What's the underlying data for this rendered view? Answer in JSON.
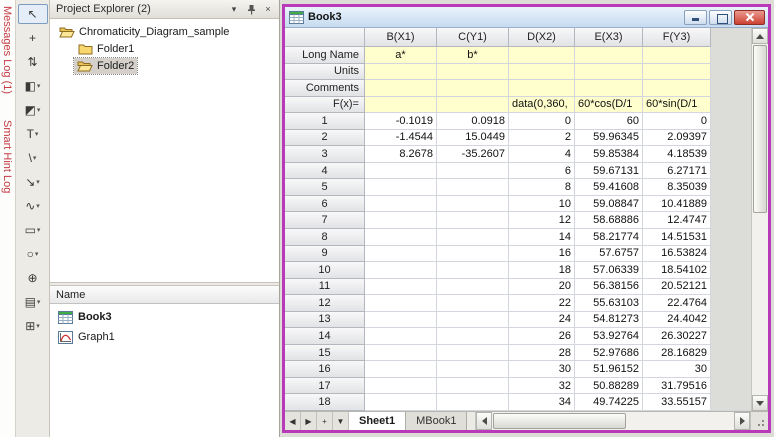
{
  "colors": {
    "active_window_border": "#b93ab9",
    "label_row_background": "#ffffcd",
    "dock_tab_text": "#c43b44"
  },
  "dock_tabs": [
    {
      "label": "Messages Log (1)"
    },
    {
      "label": "Smart Hint Log"
    }
  ],
  "toolbar": {
    "items": [
      {
        "name": "pointer-tool",
        "glyph": "↖",
        "dropdown": false,
        "selected": true
      },
      {
        "name": "screen-reader-tool",
        "glyph": "+",
        "dropdown": false,
        "selected": false
      },
      {
        "name": "data-selector-tool",
        "glyph": "⇅",
        "dropdown": false,
        "selected": false
      },
      {
        "name": "mask-tool",
        "glyph": "◧",
        "dropdown": true,
        "selected": false
      },
      {
        "name": "draw-data-tool",
        "glyph": "◩",
        "dropdown": true,
        "selected": false
      },
      {
        "name": "text-tool",
        "glyph": "T",
        "dropdown": true,
        "selected": false
      },
      {
        "name": "line-tool",
        "glyph": "\\",
        "dropdown": true,
        "selected": false
      },
      {
        "name": "arrow-tool",
        "glyph": "↘",
        "dropdown": true,
        "selected": false
      },
      {
        "name": "curve-tool",
        "glyph": "∿",
        "dropdown": true,
        "selected": false
      },
      {
        "name": "rectangle-tool",
        "glyph": "▭",
        "dropdown": true,
        "selected": false
      },
      {
        "name": "circle-tool",
        "glyph": "○",
        "dropdown": true,
        "selected": false
      },
      {
        "name": "pan-tool",
        "glyph": "⊕",
        "dropdown": false,
        "selected": false
      },
      {
        "name": "fill-area-tool",
        "glyph": "▤",
        "dropdown": true,
        "selected": false
      },
      {
        "name": "insert-graph-tool",
        "glyph": "⊞",
        "dropdown": true,
        "selected": false
      }
    ]
  },
  "project_explorer": {
    "title": "Project Explorer (2)",
    "buttons": [
      {
        "name": "window-position",
        "glyph": "▾"
      },
      {
        "name": "auto-hide-pin",
        "glyph": "pin"
      },
      {
        "name": "close",
        "glyph": "×"
      }
    ],
    "tree": [
      {
        "label": "Chromaticity_Diagram_sample",
        "level": 0,
        "icon": "folder-open",
        "selected": false
      },
      {
        "label": "Folder1",
        "level": 1,
        "icon": "folder-closed",
        "selected": false
      },
      {
        "label": "Folder2",
        "level": 1,
        "icon": "folder-open",
        "selected": true
      }
    ],
    "list": {
      "header": "Name",
      "items": [
        {
          "label": "Book3",
          "icon": "worksheet",
          "bold": true
        },
        {
          "label": "Graph1",
          "icon": "graph",
          "bold": false
        }
      ]
    }
  },
  "book_window": {
    "title": "Book3",
    "window_buttons": [
      "minimize",
      "maximize",
      "close"
    ],
    "columns": [
      "B(X1)",
      "C(Y1)",
      "D(X2)",
      "E(X3)",
      "F(Y3)"
    ],
    "label_rows": [
      {
        "header": "Long Name",
        "align": "center",
        "cells": [
          "a*",
          "b*",
          "",
          "",
          ""
        ]
      },
      {
        "header": "Units",
        "align": "center",
        "cells": [
          "",
          "",
          "",
          "",
          ""
        ]
      },
      {
        "header": "Comments",
        "align": "center",
        "cells": [
          "",
          "",
          "",
          "",
          ""
        ]
      },
      {
        "header": "F(x)=",
        "align": "left",
        "cells": [
          "",
          "",
          "data(0,360,",
          "60*cos(D/1",
          "60*sin(D/1"
        ]
      }
    ],
    "data_rows": [
      {
        "header": "1",
        "cells": [
          "-0.1019",
          "0.0918",
          "0",
          "60",
          "0"
        ]
      },
      {
        "header": "2",
        "cells": [
          "-1.4544",
          "15.0449",
          "2",
          "59.96345",
          "2.09397"
        ]
      },
      {
        "header": "3",
        "cells": [
          "8.2678",
          "-35.2607",
          "4",
          "59.85384",
          "4.18539"
        ]
      },
      {
        "header": "4",
        "cells": [
          "",
          "",
          "6",
          "59.67131",
          "6.27171"
        ]
      },
      {
        "header": "5",
        "cells": [
          "",
          "",
          "8",
          "59.41608",
          "8.35039"
        ]
      },
      {
        "header": "6",
        "cells": [
          "",
          "",
          "10",
          "59.08847",
          "10.41889"
        ]
      },
      {
        "header": "7",
        "cells": [
          "",
          "",
          "12",
          "58.68886",
          "12.4747"
        ]
      },
      {
        "header": "8",
        "cells": [
          "",
          "",
          "14",
          "58.21774",
          "14.51531"
        ]
      },
      {
        "header": "9",
        "cells": [
          "",
          "",
          "16",
          "57.6757",
          "16.53824"
        ]
      },
      {
        "header": "10",
        "cells": [
          "",
          "",
          "18",
          "57.06339",
          "18.54102"
        ]
      },
      {
        "header": "11",
        "cells": [
          "",
          "",
          "20",
          "56.38156",
          "20.52121"
        ]
      },
      {
        "header": "12",
        "cells": [
          "",
          "",
          "22",
          "55.63103",
          "22.4764"
        ]
      },
      {
        "header": "13",
        "cells": [
          "",
          "",
          "24",
          "54.81273",
          "24.4042"
        ]
      },
      {
        "header": "14",
        "cells": [
          "",
          "",
          "26",
          "53.92764",
          "26.30227"
        ]
      },
      {
        "header": "15",
        "cells": [
          "",
          "",
          "28",
          "52.97686",
          "28.16829"
        ]
      },
      {
        "header": "16",
        "cells": [
          "",
          "",
          "30",
          "51.96152",
          "30"
        ]
      },
      {
        "header": "17",
        "cells": [
          "",
          "",
          "32",
          "50.88289",
          "31.79516"
        ]
      },
      {
        "header": "18",
        "cells": [
          "",
          "",
          "34",
          "49.74225",
          "33.55157"
        ]
      }
    ],
    "tab_nav": [
      {
        "name": "scroll-tabs-left",
        "glyph": "◀"
      },
      {
        "name": "scroll-tabs-right",
        "glyph": "▶"
      },
      {
        "name": "add-sheet",
        "glyph": "+"
      },
      {
        "name": "sheet-list",
        "glyph": "▼"
      }
    ],
    "sheet_tabs": [
      {
        "label": "Sheet1",
        "active": true
      },
      {
        "label": "MBook1",
        "active": false
      }
    ]
  }
}
